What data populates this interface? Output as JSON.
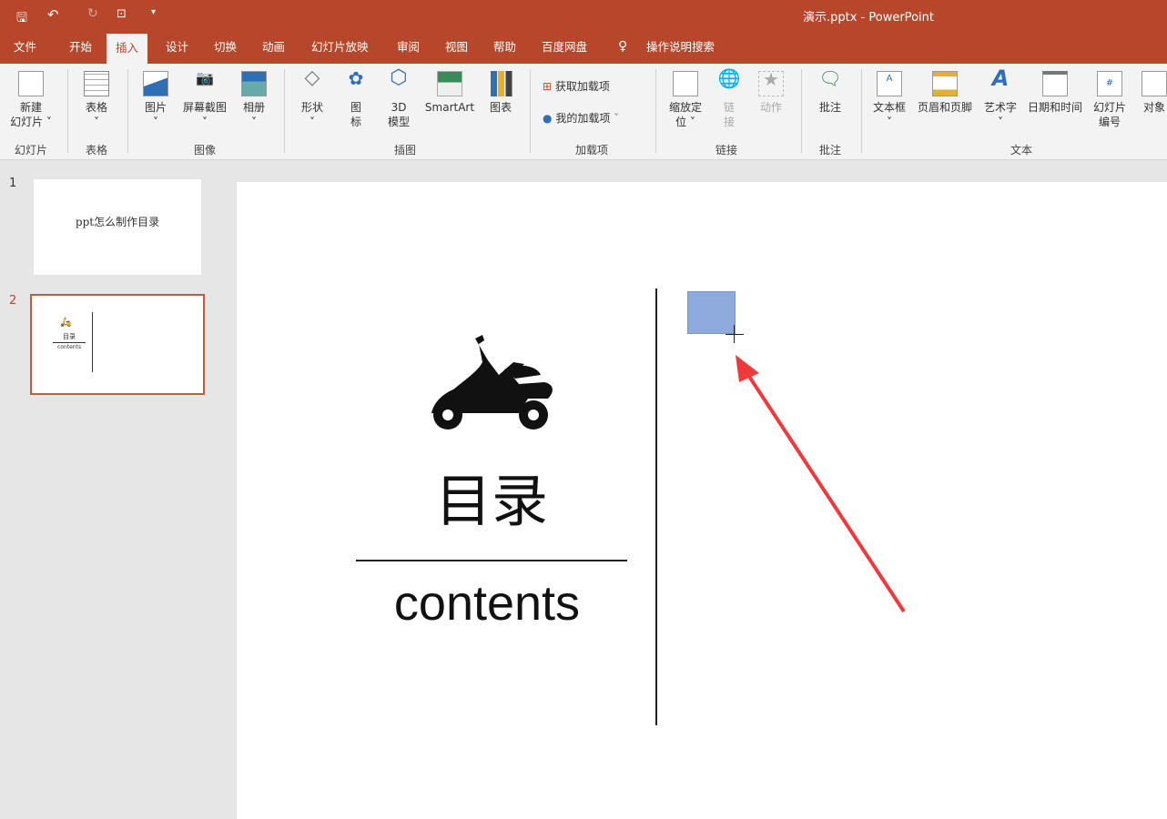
{
  "app": {
    "title": "演示.pptx  -  PowerPoint"
  },
  "qat": {
    "save": "save-icon",
    "undo": "undo-icon",
    "redo": "redo-icon",
    "present": "present-icon",
    "more": "customize-icon"
  },
  "tabs": [
    "文件",
    "开始",
    "插入",
    "设计",
    "切换",
    "动画",
    "幻灯片放映",
    "审阅",
    "视图",
    "帮助",
    "百度网盘"
  ],
  "active_tab": "插入",
  "search": {
    "label": "操作说明搜索"
  },
  "ribbon": {
    "new_slide": [
      "新建",
      "幻灯片 ˅"
    ],
    "table": "表格",
    "picture": "图片",
    "screenshot": "屏幕截图",
    "album": "相册",
    "shapes": "形状",
    "icons": [
      "图",
      "标"
    ],
    "model3d": [
      "3D",
      "模型"
    ],
    "smartart": "SmartArt",
    "chart": "图表",
    "get_addins": "获取加载项",
    "my_addins": "我的加载项",
    "zoom": [
      "缩放定",
      "位 ˅"
    ],
    "link": [
      "链",
      "接"
    ],
    "action": "动作",
    "comment": "批注",
    "textbox": "文本框",
    "header_footer": "页眉和页脚",
    "wordart": "艺术字",
    "datetime": "日期和时间",
    "slide_number": [
      "幻灯片",
      "编号"
    ],
    "object": "对象",
    "groups": [
      "幻灯片",
      "表格",
      "图像",
      "插图",
      "加载项",
      "链接",
      "批注",
      "文本"
    ]
  },
  "slides": [
    {
      "number": "1",
      "title": "ppt怎么制作目录"
    },
    {
      "number": "2",
      "title": "目录",
      "subtitle": "contents"
    }
  ],
  "slide": {
    "title": "目录",
    "subtitle": "contents"
  },
  "colors": {
    "accent": "#B7472A",
    "shape_fill": "#8FAADC",
    "arrow": "#F0393B"
  }
}
